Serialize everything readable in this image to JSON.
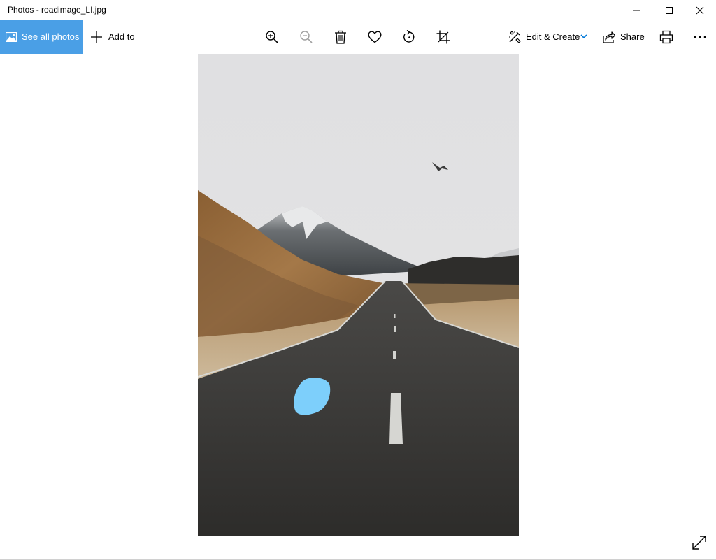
{
  "window": {
    "title": "Photos - roadimage_LI.jpg"
  },
  "toolbar": {
    "see_all_label": "See all photos",
    "add_to_label": "Add to",
    "edit_create_label": "Edit & Create",
    "share_label": "Share",
    "icons": [
      "zoom-in-icon",
      "zoom-out-icon",
      "delete-icon",
      "favorite-icon",
      "rotate-icon",
      "crop-icon",
      "print-icon",
      "more-icon"
    ]
  },
  "colors": {
    "accent": "#4a9fe6",
    "chevron": "#0078d7",
    "blob": "#7dcffb"
  }
}
